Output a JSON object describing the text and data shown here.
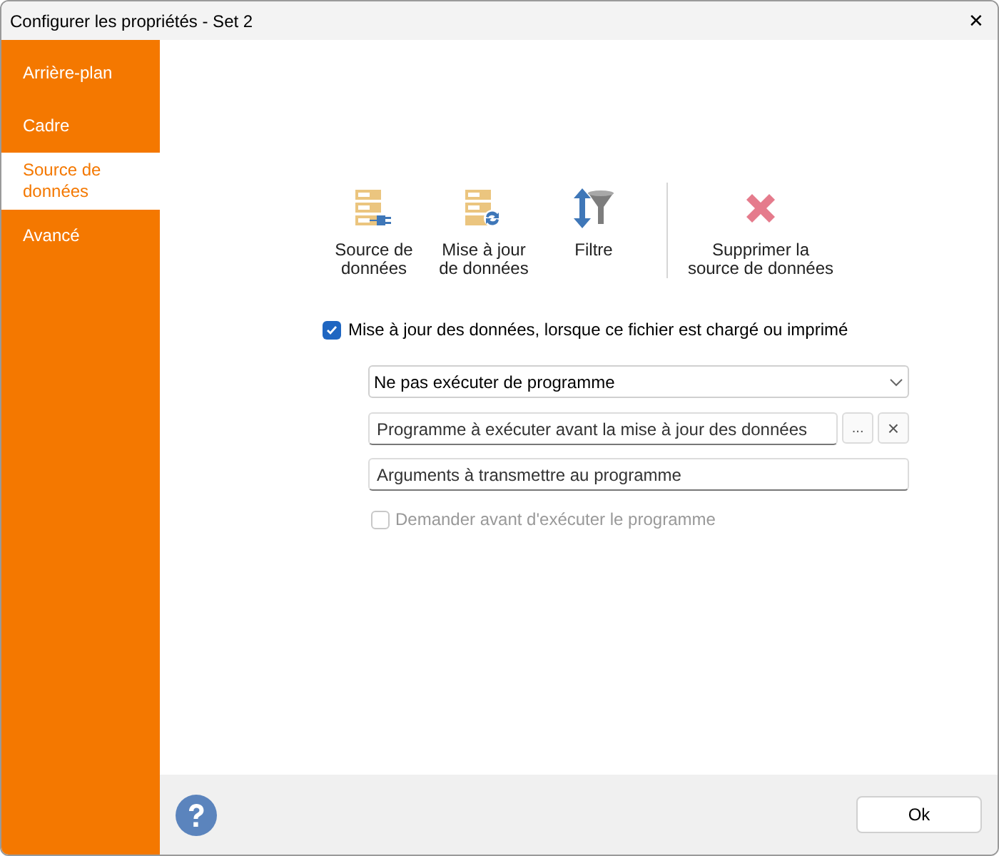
{
  "window": {
    "title": "Configurer les propriétés - Set 2",
    "close": "✕"
  },
  "sidebar": {
    "items": [
      {
        "label": "Arrière-plan",
        "selected": false
      },
      {
        "label": "Cadre",
        "selected": false
      },
      {
        "label": "Source de données",
        "selected": true
      },
      {
        "label": "Avancé",
        "selected": false
      }
    ]
  },
  "toolbar": [
    {
      "kind": "source",
      "label": "Source de données"
    },
    {
      "kind": "refresh",
      "label": "Mise à jour de données"
    },
    {
      "kind": "filter",
      "label": "Filtre"
    },
    {
      "kind": "delete",
      "label": "Supprimer la source de données"
    }
  ],
  "update_checkbox": {
    "label": "Mise à jour des données, lorsque ce fichier est chargé ou imprimé",
    "checked": true,
    "disabled": false
  },
  "program_dropdown": {
    "value": "Ne pas exécuter de programme"
  },
  "program_field": {
    "placeholder": "Programme à exécuter avant la mise à jour des données",
    "browse": "...",
    "clear": "×"
  },
  "arguments_field": {
    "placeholder": "Arguments à transmettre au programme"
  },
  "ask_checkbox": {
    "label": "Demander avant d'exécuter le programme",
    "checked": false,
    "disabled": true
  },
  "footer": {
    "ok": "Ok"
  }
}
